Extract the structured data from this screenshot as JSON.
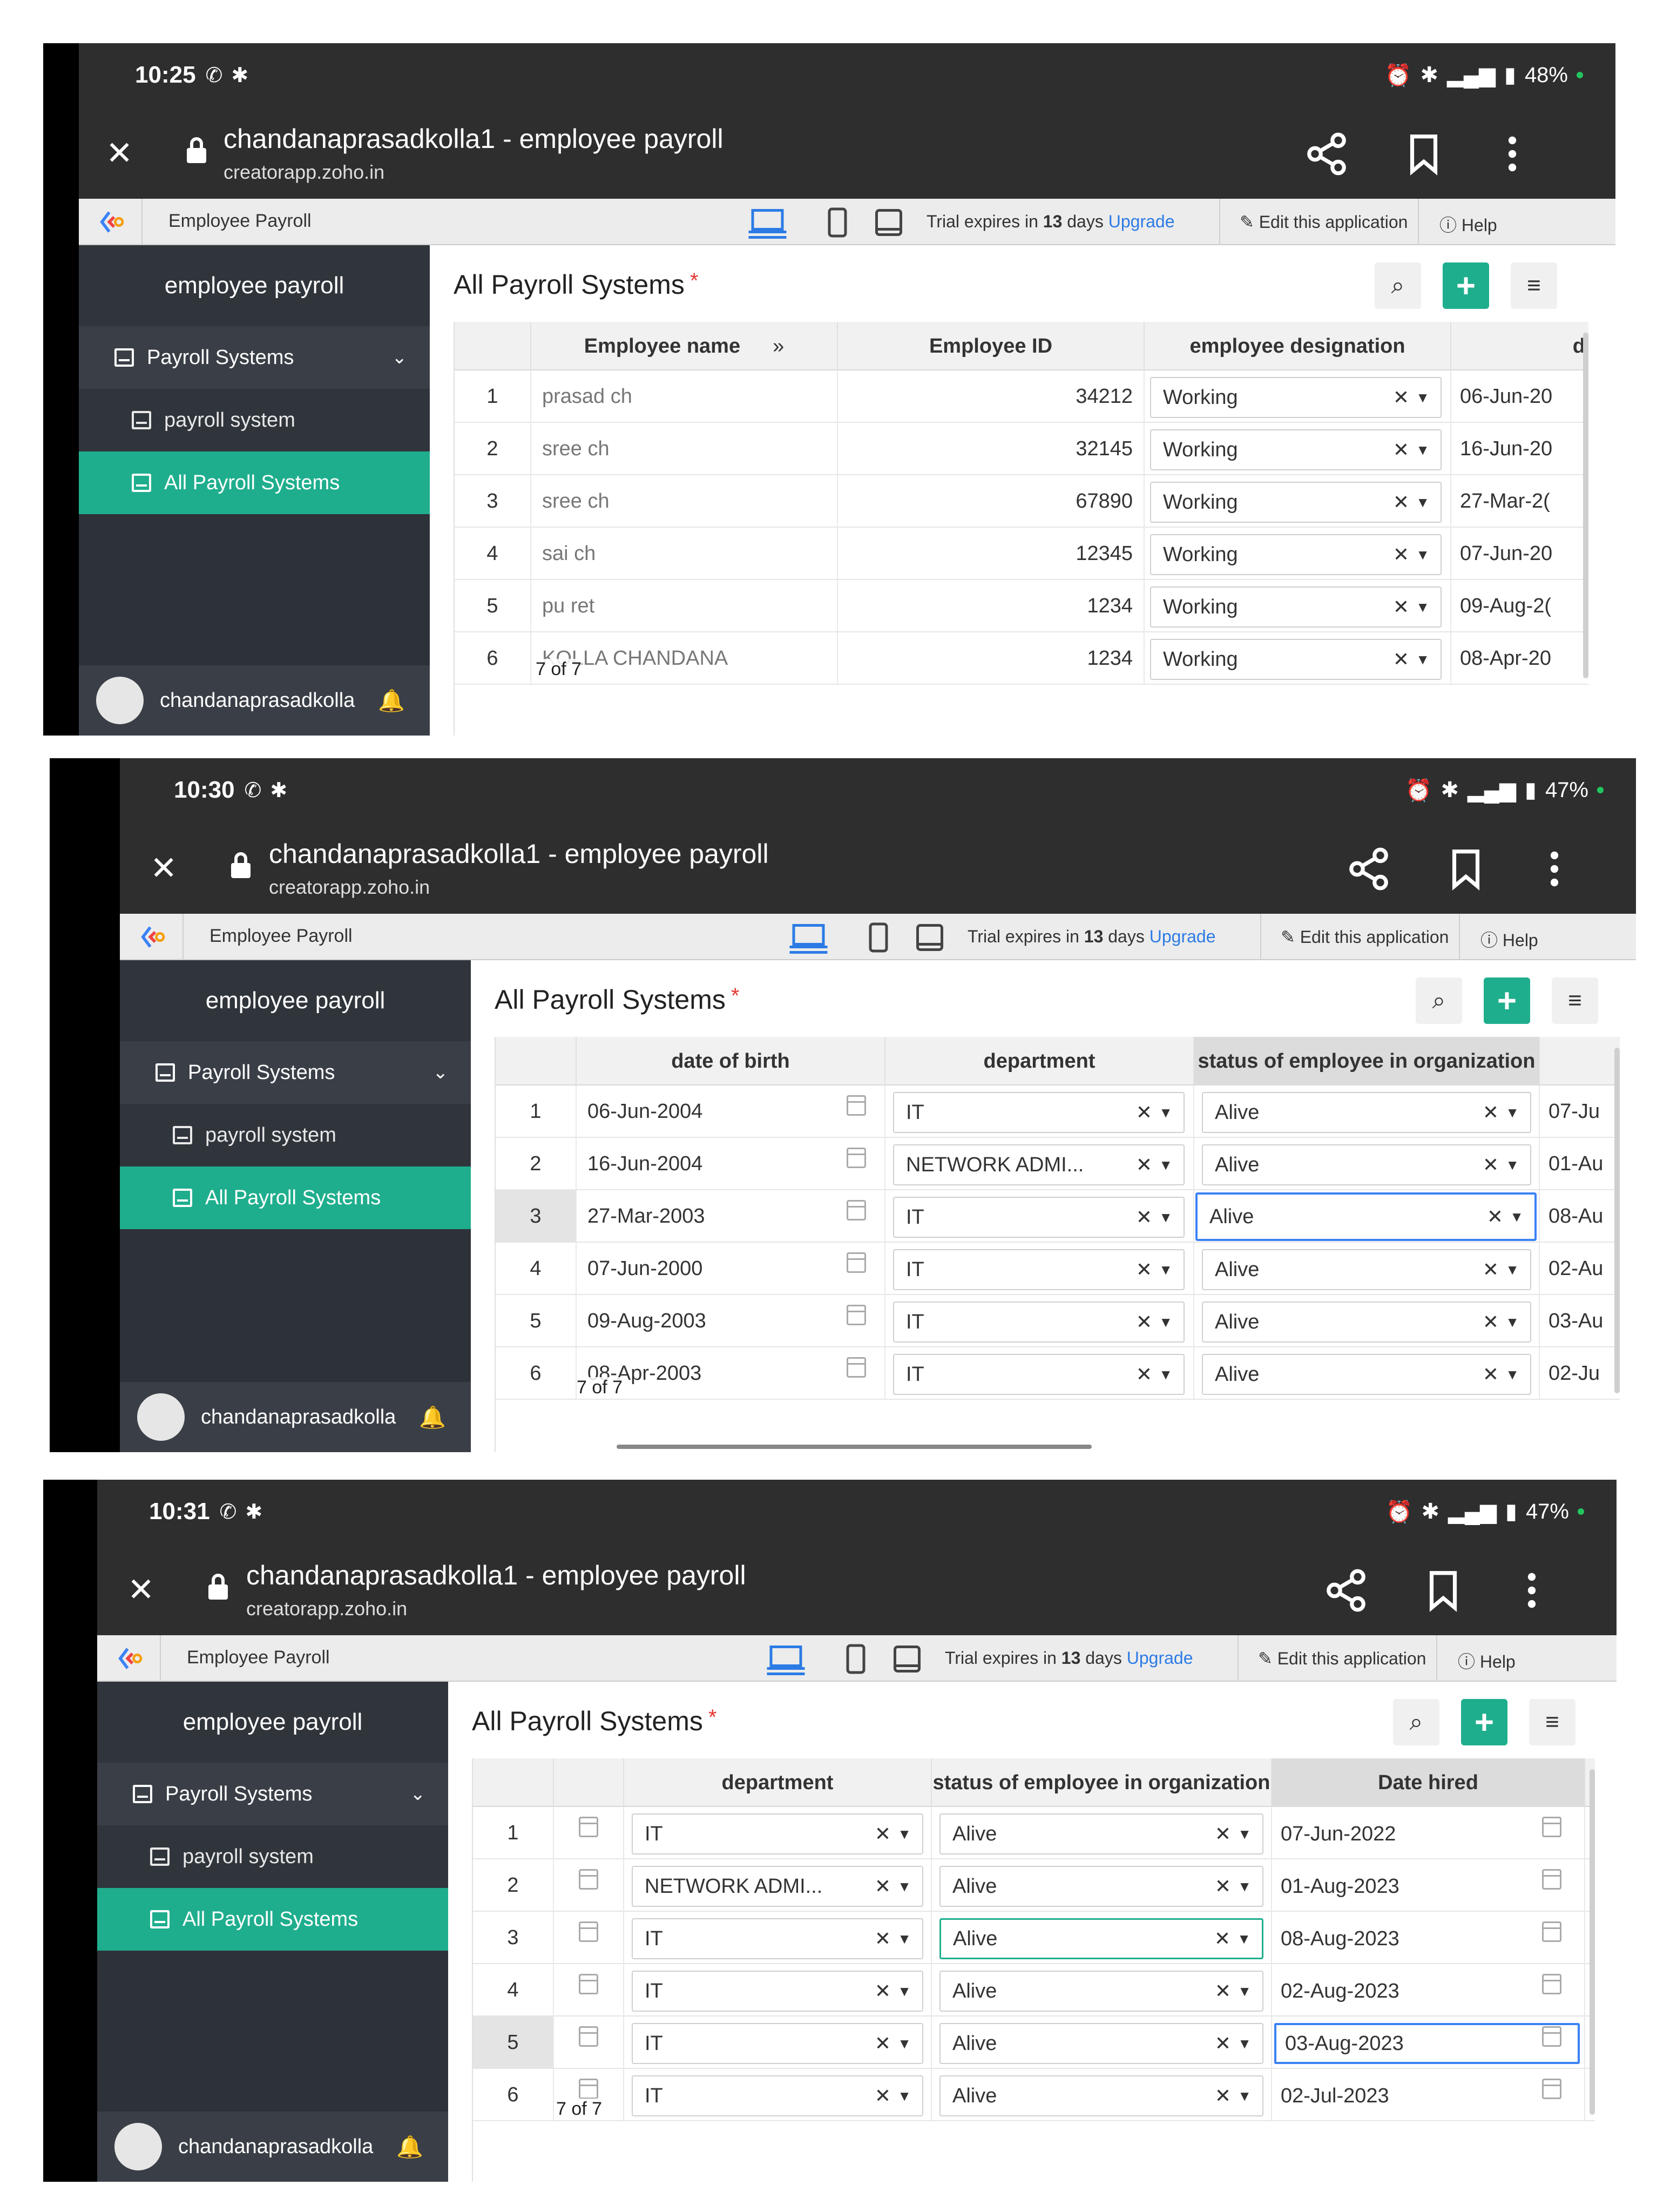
{
  "common": {
    "page_title": "chandanaprasadkolla1 - employee payroll",
    "page_domain": "creatorapp.zoho.in",
    "app_name": "Employee Payroll",
    "trial_prefix": "Trial expires in ",
    "trial_days": "13",
    "trial_suffix": " days ",
    "upgrade": "Upgrade",
    "edit_app": "Edit this application",
    "help": "Help",
    "brand": "employee payroll",
    "nav_group": "Payroll Systems",
    "nav_item_1": "payroll system",
    "nav_item_2": "All Payroll Systems",
    "user": "chandanaprasadkolla",
    "report_title": "All Payroll Systems",
    "required_mark": "*",
    "pager": "7 of 7",
    "accent": "#1fae8d",
    "link_color": "#2c7be5"
  },
  "s1": {
    "time": "10:25",
    "battery": "48%",
    "headers": [
      "",
      "Employee name",
      "Employee ID",
      "employee designation",
      "d"
    ],
    "rows": [
      {
        "n": "1",
        "name": "prasad ch",
        "id": "34212",
        "desig": "Working",
        "dob": "06-Jun-20"
      },
      {
        "n": "2",
        "name": "sree ch",
        "id": "32145",
        "desig": "Working",
        "dob": "16-Jun-20"
      },
      {
        "n": "3",
        "name": "sree ch",
        "id": "67890",
        "desig": "Working",
        "dob": "27-Mar-2("
      },
      {
        "n": "4",
        "name": "sai ch",
        "id": "12345",
        "desig": "Working",
        "dob": "07-Jun-20"
      },
      {
        "n": "5",
        "name": "pu ret",
        "id": "1234",
        "desig": "Working",
        "dob": "09-Aug-2("
      },
      {
        "n": "6",
        "name": "KOLLA CHANDANA",
        "id": "1234",
        "desig": "Working",
        "dob": "08-Apr-20"
      }
    ]
  },
  "s2": {
    "time": "10:30",
    "battery": "47%",
    "headers": [
      "",
      "date of birth",
      "department",
      "status of employee in organization"
    ],
    "rows": [
      {
        "n": "1",
        "dob": "06-Jun-2004",
        "dept": "IT",
        "status": "Alive",
        "hired": "07-Ju"
      },
      {
        "n": "2",
        "dob": "16-Jun-2004",
        "dept": "NETWORK ADMI...",
        "status": "Alive",
        "hired": "01-Au"
      },
      {
        "n": "3",
        "dob": "27-Mar-2003",
        "dept": "IT",
        "status": "Alive",
        "hired": "08-Au"
      },
      {
        "n": "4",
        "dob": "07-Jun-2000",
        "dept": "IT",
        "status": "Alive",
        "hired": "02-Au"
      },
      {
        "n": "5",
        "dob": "09-Aug-2003",
        "dept": "IT",
        "status": "Alive",
        "hired": "03-Au"
      },
      {
        "n": "6",
        "dob": "08-Apr-2003",
        "dept": "IT",
        "status": "Alive",
        "hired": "02-Ju"
      }
    ]
  },
  "s3": {
    "time": "10:31",
    "battery": "47%",
    "headers": [
      "",
      "",
      "department",
      "status of employee in organization",
      "Date hired"
    ],
    "rows": [
      {
        "n": "1",
        "dept": "IT",
        "status": "Alive",
        "hired": "07-Jun-2022"
      },
      {
        "n": "2",
        "dept": "NETWORK ADMI...",
        "status": "Alive",
        "hired": "01-Aug-2023"
      },
      {
        "n": "3",
        "dept": "IT",
        "status": "Alive",
        "hired": "08-Aug-2023"
      },
      {
        "n": "4",
        "dept": "IT",
        "status": "Alive",
        "hired": "02-Aug-2023"
      },
      {
        "n": "5",
        "dept": "IT",
        "status": "Alive",
        "hired": "03-Aug-2023"
      },
      {
        "n": "6",
        "dept": "IT",
        "status": "Alive",
        "hired": "02-Jul-2023"
      }
    ]
  }
}
